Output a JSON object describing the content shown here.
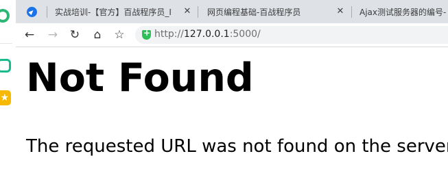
{
  "tabs": [
    {
      "title": "实战培训-【官方】百战程序员_IT(",
      "active": false,
      "close_label": "✕"
    },
    {
      "title": "网页编程基础-百战程序员",
      "active": false,
      "close_label": "✕"
    },
    {
      "title": "Ajax测试服务器的编号-",
      "active": false,
      "close_label": ""
    }
  ],
  "toolbar": {
    "back_icon": "←",
    "forward_icon": "→",
    "reload_icon": "↻",
    "home_icon": "⌂",
    "favorites_icon": "☆"
  },
  "address": {
    "protocol": "http://",
    "host": "127.0.0.1",
    "port_path": ":5000/"
  },
  "page": {
    "heading": "Not Found",
    "message": "The requested URL was not found on the server. If you entered the URL manually please check your spelling and try again."
  },
  "sidebar": {
    "star_icon": "★"
  },
  "colors": {
    "tabstrip_bg": "#dee1e6",
    "accent_green": "#2ebd59",
    "accent_blue": "#1a73e8"
  }
}
